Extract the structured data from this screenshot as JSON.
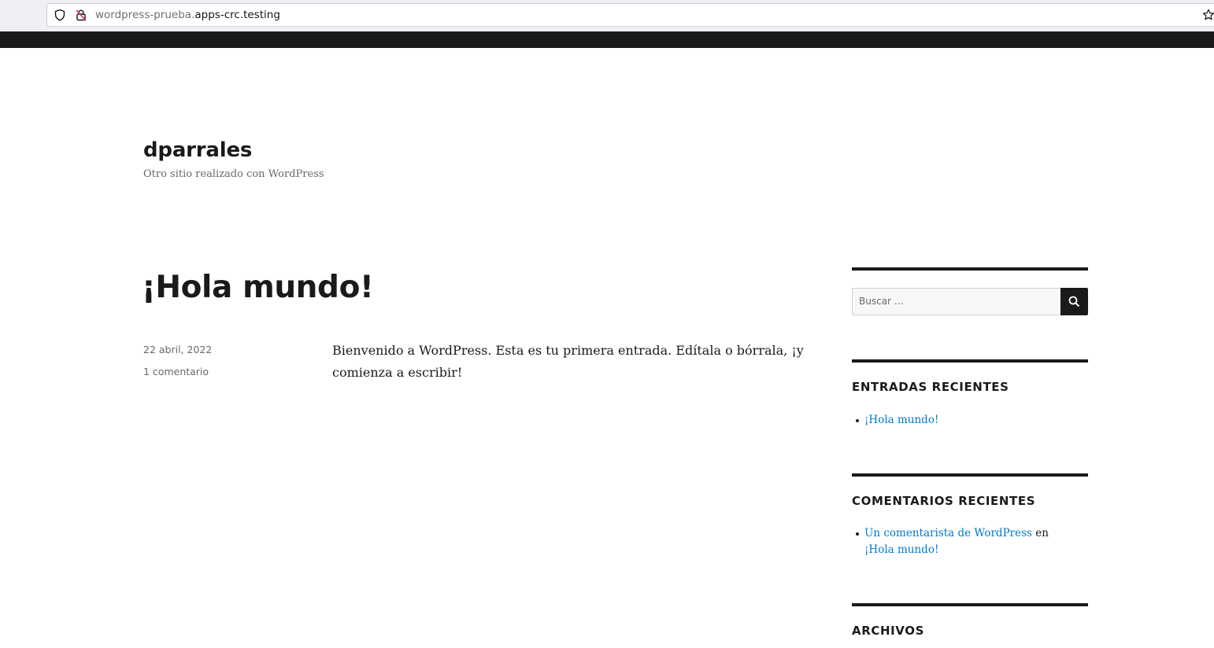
{
  "browser": {
    "url_subdomain": "wordpress-prueba.",
    "url_domain": "apps-crc.testing"
  },
  "site": {
    "title": "dparrales",
    "description": "Otro sitio realizado con WordPress"
  },
  "post": {
    "title": "¡Hola mundo!",
    "date": "22 abril, 2022",
    "comments": "1 comentario",
    "body": "Bienvenido a WordPress. Esta es tu primera entrada. Edítala o bórrala, ¡y comienza a escribir!"
  },
  "sidebar": {
    "search_placeholder": "Buscar …",
    "recent_posts": {
      "title": "ENTRADAS RECIENTES",
      "items": [
        {
          "label": "¡Hola mundo!"
        }
      ]
    },
    "recent_comments": {
      "title": "COMENTARIOS RECIENTES",
      "items": [
        {
          "author": "Un comentarista de WordPress",
          "connector": "en",
          "post": "¡Hola mundo!"
        }
      ]
    },
    "archives": {
      "title": "ARCHIVOS"
    }
  },
  "colors": {
    "link": "#007acc",
    "text": "#1a1a1a",
    "muted": "#686868",
    "topband": "#1a1a1a"
  },
  "icons": {
    "shield": "shield-icon",
    "insecure_lock": "insecure-lock-icon",
    "bookmark": "star-icon",
    "search": "search-icon"
  }
}
